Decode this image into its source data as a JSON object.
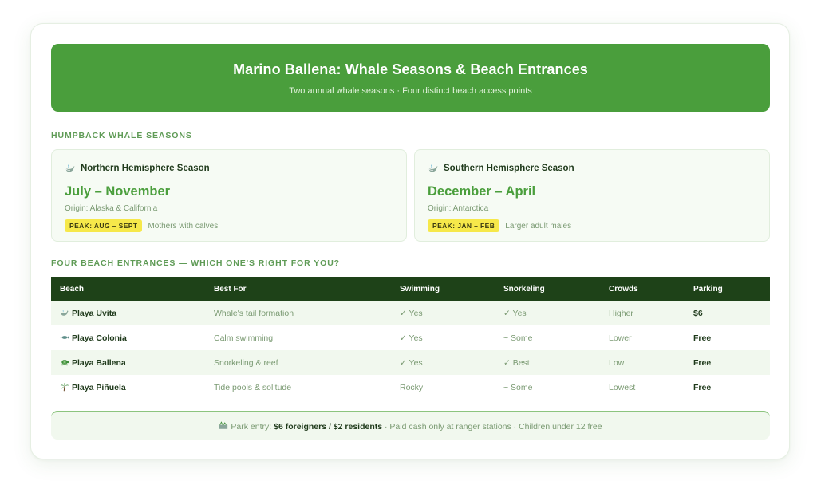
{
  "header": {
    "title": "Marino Ballena: Whale Seasons & Beach Entrances",
    "subtitle": "Two annual whale seasons · Four distinct beach access points"
  },
  "seasons_section": {
    "title": "HUMPBACK WHALE SEASONS",
    "cards": [
      {
        "icon": "whale-icon",
        "name": "Northern Hemisphere Season",
        "months": "July – November",
        "origin": "Origin: Alaska & California",
        "peak": "PEAK: AUG – SEPT",
        "note": "Mothers with calves"
      },
      {
        "icon": "whale-icon",
        "name": "Southern Hemisphere Season",
        "months": "December – April",
        "origin": "Origin: Antarctica",
        "peak": "PEAK: JAN – FEB",
        "note": "Larger adult males"
      }
    ]
  },
  "beaches_section": {
    "title": "FOUR BEACH ENTRANCES — WHICH ONE'S RIGHT FOR YOU?",
    "columns": [
      "Beach",
      "Best For",
      "Swimming",
      "Snorkeling",
      "Crowds",
      "Parking"
    ],
    "rows": [
      {
        "icon": "whale-icon",
        "beach": "Playa Uvita",
        "best_for": "Whale's tail formation",
        "swimming": "✓ Yes",
        "snorkeling": "✓ Yes",
        "crowds": "Higher",
        "parking": "$6"
      },
      {
        "icon": "fish-icon",
        "beach": "Playa Colonia",
        "best_for": "Calm swimming",
        "swimming": "✓ Yes",
        "snorkeling": "~ Some",
        "crowds": "Lower",
        "parking": "Free"
      },
      {
        "icon": "turtle-icon",
        "beach": "Playa Ballena",
        "best_for": "Snorkeling & reef",
        "swimming": "✓ Yes",
        "snorkeling": "✓ Best",
        "crowds": "Low",
        "parking": "Free"
      },
      {
        "icon": "palm-tree-icon",
        "beach": "Playa Piñuela",
        "best_for": "Tide pools & solitude",
        "swimming": "Rocky",
        "snorkeling": "~ Some",
        "crowds": "Lowest",
        "parking": "Free"
      }
    ]
  },
  "footer": {
    "icon": "ticket-icon",
    "prefix": "Park entry:",
    "price": "$6 foreigners / $2 residents",
    "suffix": "· Paid cash only at ranger stations · Children under 12 free"
  },
  "colors": {
    "brand_green": "#4a9e3c",
    "dark_green": "#1e4218",
    "peak_yellow": "#f6e84a"
  }
}
